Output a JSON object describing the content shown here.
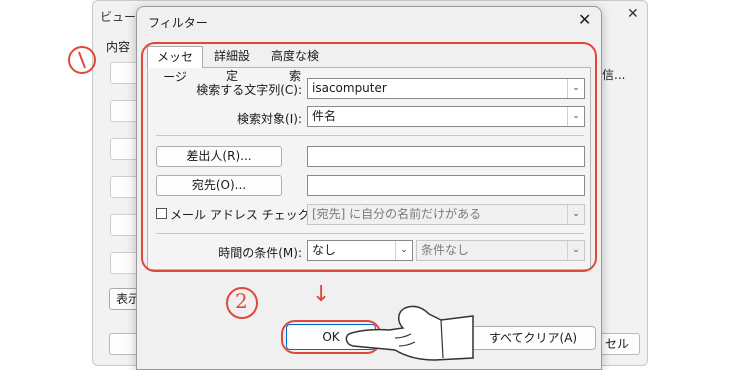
{
  "background_dialog": {
    "title": "ビューの設",
    "content_label": "内容",
    "display_button": "表示",
    "right_text": "信...",
    "cancel_button": "セル"
  },
  "filter_dialog": {
    "title": "フィルター",
    "tabs": [
      "メッセージ",
      "詳細設定",
      "高度な検索"
    ],
    "search_text_label": "検索する文字列(C):",
    "search_text_value": "isacomputer",
    "search_in_label": "検索対象(I):",
    "search_in_value": "件名",
    "from_button": "差出人(R)...",
    "from_value": "",
    "sent_to_button": "宛先(O)...",
    "sent_to_value": "",
    "mail_address_check_label": "メール アドレス チェック(W):",
    "mail_address_check_value": "[宛先] に自分の名前だけがある",
    "time_label": "時間の条件(M):",
    "time_value": "なし",
    "time_condition_value": "条件なし",
    "ok_button": "OK",
    "clear_button": "すべてクリア(A)"
  },
  "annotations": {
    "step1": "1",
    "step2": "2",
    "arrow": "↓"
  },
  "colors": {
    "annotation_red": "#e0483a",
    "ok_border_blue": "#0067c0"
  }
}
